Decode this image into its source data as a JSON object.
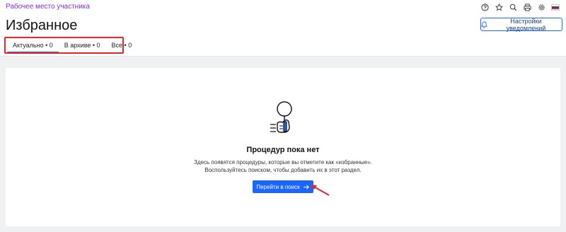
{
  "header": {
    "app_link": "Рабочее место участника",
    "icons": [
      "help-icon",
      "star-icon",
      "search-icon",
      "print-icon",
      "settings-icon",
      "flag-icon"
    ],
    "flag_colors": [
      "#ffffff",
      "#1c3fa8",
      "#d52b1e"
    ]
  },
  "page": {
    "title": "Избранное",
    "notify_button": "Настройки уведомлений"
  },
  "tabs": [
    {
      "label": "Актуально • 0",
      "active": true
    },
    {
      "label": "В архиве • 0",
      "active": false
    },
    {
      "label": "Все • 0",
      "active": false
    }
  ],
  "empty_state": {
    "title": "Процедур пока нет",
    "description_line1": "Здесь появятся процедуры, которые вы отметите как «избранные».",
    "description_line2": "Воспользуйтесь поиском, чтобы добавить их в этот раздел.",
    "button_label": "Перейти в поиск",
    "button_icon": "arrow-right-icon"
  },
  "colors": {
    "accent": "#1a66ff",
    "link": "#7b2fd6",
    "annotation": "#e0262b"
  }
}
